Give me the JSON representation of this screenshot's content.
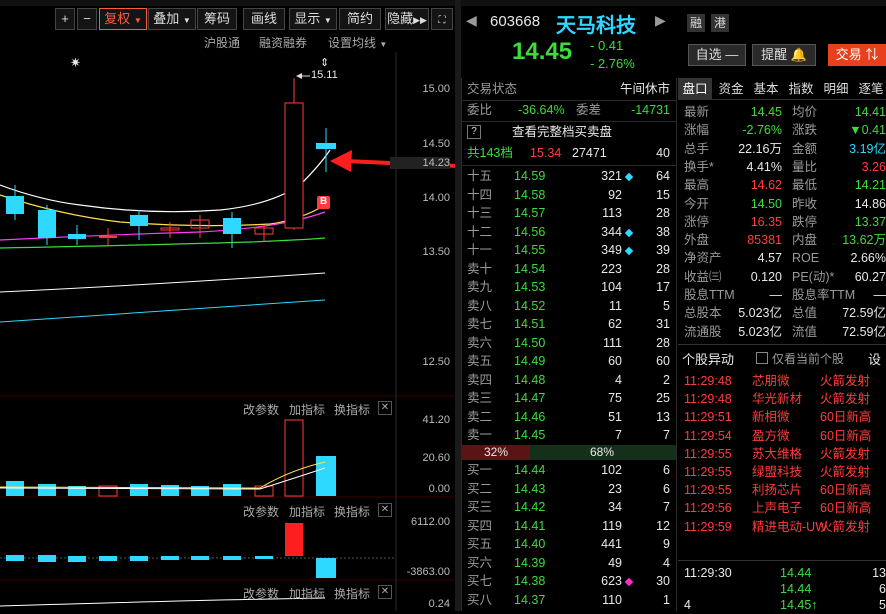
{
  "toolbar": {
    "buttons": [
      "+",
      "−",
      "复权",
      "叠加",
      "筹码",
      "画线",
      "显示",
      "简约",
      "隐藏"
    ],
    "links": [
      "沪股通",
      "融资融券",
      "设置均线"
    ]
  },
  "chart": {
    "price_labels": [
      "15.00",
      "14.50",
      "14.23",
      "14.00",
      "13.50",
      "12.50"
    ],
    "high_marker": "15.11",
    "b_marker": "B",
    "star": "✷",
    "updown": "⇕"
  },
  "vol_panel": {
    "labels": [
      "改参数",
      "加指标",
      "换指标"
    ],
    "axis": [
      "41.20",
      "20.60",
      "0.00"
    ]
  },
  "macd_panel": {
    "labels": [
      "改参数",
      "加指标",
      "换指标"
    ],
    "axis": [
      "6112.00",
      "-3863.00"
    ]
  },
  "third_panel": {
    "labels": [
      "改参数",
      "加指标",
      "换指标"
    ],
    "axis": [
      "0.24"
    ]
  },
  "stock": {
    "code": "603668",
    "name": "天马科技",
    "tags": [
      "融",
      "港"
    ],
    "price": "14.45",
    "change": "- 0.41",
    "change_pct": "- 2.76%",
    "watch_btn": "自选",
    "alert_btn": "提醒",
    "trade_btn": "交易"
  },
  "orderbook": {
    "status_label": "交易状态",
    "status_value": "午间休市",
    "ratio_label": "委比",
    "ratio_value": "-36.64%",
    "diff_label": "委差",
    "diff_value": "-14731",
    "full_book": "查看完整档买卖盘",
    "levels_label": "共143档",
    "levels_price": "15.34",
    "levels_vol": "27471",
    "levels_cnt": "40",
    "sells": [
      {
        "label": "十五",
        "price": "14.59",
        "vol": "321",
        "cnt": "64",
        "mark": "cyan"
      },
      {
        "label": "十四",
        "price": "14.58",
        "vol": "92",
        "cnt": "15",
        "mark": ""
      },
      {
        "label": "十三",
        "price": "14.57",
        "vol": "113",
        "cnt": "28",
        "mark": ""
      },
      {
        "label": "十二",
        "price": "14.56",
        "vol": "344",
        "cnt": "38",
        "mark": "cyan"
      },
      {
        "label": "十一",
        "price": "14.55",
        "vol": "349",
        "cnt": "39",
        "mark": "cyan"
      },
      {
        "label": "卖十",
        "price": "14.54",
        "vol": "223",
        "cnt": "28",
        "mark": ""
      },
      {
        "label": "卖九",
        "price": "14.53",
        "vol": "104",
        "cnt": "17",
        "mark": ""
      },
      {
        "label": "卖八",
        "price": "14.52",
        "vol": "11",
        "cnt": "5",
        "mark": ""
      },
      {
        "label": "卖七",
        "price": "14.51",
        "vol": "62",
        "cnt": "31",
        "mark": ""
      },
      {
        "label": "卖六",
        "price": "14.50",
        "vol": "111",
        "cnt": "28",
        "mark": ""
      },
      {
        "label": "卖五",
        "price": "14.49",
        "vol": "60",
        "cnt": "60",
        "mark": ""
      },
      {
        "label": "卖四",
        "price": "14.48",
        "vol": "4",
        "cnt": "2",
        "mark": ""
      },
      {
        "label": "卖三",
        "price": "14.47",
        "vol": "75",
        "cnt": "25",
        "mark": ""
      },
      {
        "label": "卖二",
        "price": "14.46",
        "vol": "51",
        "cnt": "13",
        "mark": ""
      },
      {
        "label": "卖一",
        "price": "14.45",
        "vol": "7",
        "cnt": "7",
        "mark": ""
      }
    ],
    "split_left": "32%",
    "split_right": "68%",
    "buys": [
      {
        "label": "买一",
        "price": "14.44",
        "vol": "102",
        "cnt": "6",
        "mark": ""
      },
      {
        "label": "买二",
        "price": "14.43",
        "vol": "23",
        "cnt": "6",
        "mark": ""
      },
      {
        "label": "买三",
        "price": "14.42",
        "vol": "34",
        "cnt": "7",
        "mark": ""
      },
      {
        "label": "买四",
        "price": "14.41",
        "vol": "119",
        "cnt": "12",
        "mark": ""
      },
      {
        "label": "买五",
        "price": "14.40",
        "vol": "441",
        "cnt": "9",
        "mark": ""
      },
      {
        "label": "买六",
        "price": "14.39",
        "vol": "49",
        "cnt": "4",
        "mark": ""
      },
      {
        "label": "买七",
        "price": "14.38",
        "vol": "623",
        "cnt": "30",
        "mark": "mag"
      },
      {
        "label": "买八",
        "price": "14.37",
        "vol": "110",
        "cnt": "1",
        "mark": ""
      }
    ]
  },
  "info_tabs": [
    "盘口",
    "资金",
    "基本",
    "指数",
    "明细",
    "逐笔"
  ],
  "info": [
    {
      "l1": "最新",
      "v1": "14.45",
      "c1": "green",
      "l2": "均价",
      "v2": "14.41",
      "c2": "green"
    },
    {
      "l1": "涨幅",
      "v1": "-2.76%",
      "c1": "green",
      "l2": "涨跌",
      "v2": "▼0.41",
      "c2": "green"
    },
    {
      "l1": "总手",
      "v1": "22.16万",
      "c1": "white",
      "l2": "金额",
      "v2": "3.19亿",
      "c2": "cyan"
    },
    {
      "l1": "换手*",
      "v1": "4.41%",
      "c1": "white",
      "l2": "量比",
      "v2": "3.26",
      "c2": "red"
    },
    {
      "l1": "最高",
      "v1": "14.62",
      "c1": "red",
      "l2": "最低",
      "v2": "14.21",
      "c2": "green"
    },
    {
      "l1": "今开",
      "v1": "14.50",
      "c1": "green",
      "l2": "昨收",
      "v2": "14.86",
      "c2": "white"
    },
    {
      "l1": "涨停",
      "v1": "16.35",
      "c1": "red",
      "l2": "跌停",
      "v2": "13.37",
      "c2": "green"
    },
    {
      "l1": "外盘",
      "v1": "85381",
      "c1": "red",
      "l2": "内盘",
      "v2": "13.62万",
      "c2": "green"
    },
    {
      "l1": "净资产",
      "v1": "4.57",
      "c1": "white",
      "l2": "ROE",
      "v2": "2.66%",
      "c2": "white"
    },
    {
      "l1": "收益㈢",
      "v1": "0.120",
      "c1": "white",
      "l2": "PE(动)*",
      "v2": "60.27",
      "c2": "white"
    },
    {
      "l1": "股息TTM",
      "v1": "—",
      "c1": "white",
      "l2": "股息率TTM",
      "v2": "—",
      "c2": "white"
    },
    {
      "l1": "总股本",
      "v1": "5.023亿",
      "c1": "white",
      "l2": "总值",
      "v2": "72.59亿",
      "c2": "white"
    },
    {
      "l1": "流通股",
      "v1": "5.023亿",
      "c1": "white",
      "l2": "流值",
      "v2": "72.59亿",
      "c2": "white"
    }
  ],
  "anomaly": {
    "title": "个股异动",
    "checkbox_label": "仅看当前个股",
    "settings": "设",
    "rows": [
      {
        "time": "11:29:48",
        "name": "芯朋微",
        "event": "火箭发射"
      },
      {
        "time": "11:29:48",
        "name": "华光新材",
        "event": "火箭发射"
      },
      {
        "time": "11:29:51",
        "name": "新相微",
        "event": "60日新高"
      },
      {
        "time": "11:29:54",
        "name": "盈方微",
        "event": "60日新高"
      },
      {
        "time": "11:29:55",
        "name": "苏大维格",
        "event": "火箭发射"
      },
      {
        "time": "11:29:55",
        "name": "绿盟科技",
        "event": "火箭发射"
      },
      {
        "time": "11:29:55",
        "name": "利扬芯片",
        "event": "60日新高"
      },
      {
        "time": "11:29:56",
        "name": "上声电子",
        "event": "60日新高"
      },
      {
        "time": "11:29:59",
        "name": "精进电动-UW",
        "event": "火箭发射"
      }
    ]
  },
  "ticks": [
    {
      "time": "11:29:30",
      "price": "14.44",
      "vol": "13"
    },
    {
      "time": "",
      "price": "14.44",
      "vol": "6"
    },
    {
      "time": "4",
      "price": "14.45↑",
      "vol": "5"
    }
  ]
}
